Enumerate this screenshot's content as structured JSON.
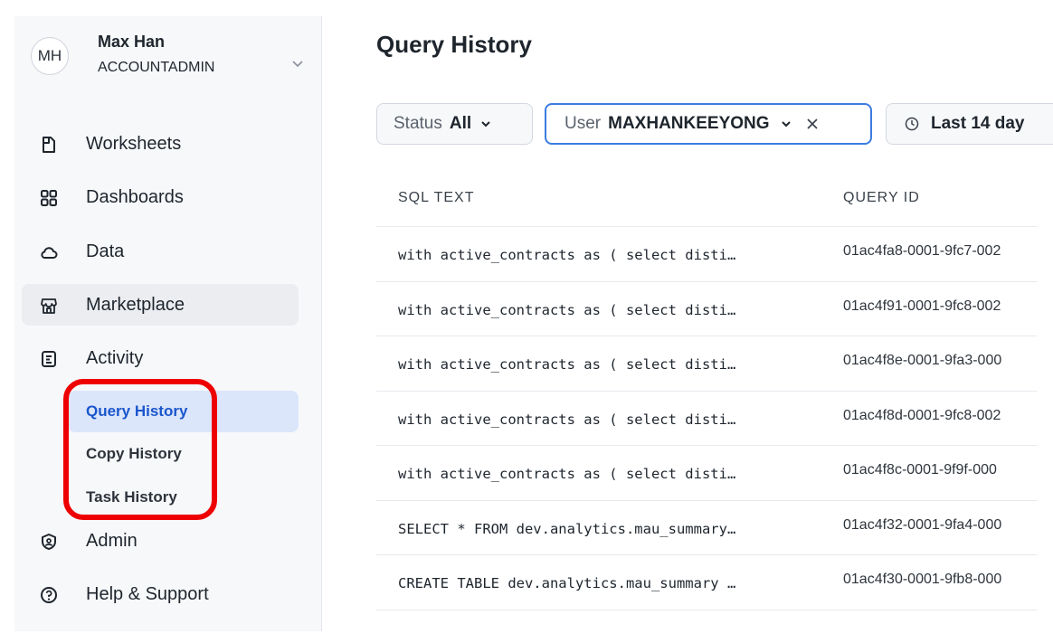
{
  "user": {
    "initials": "MH",
    "name": "Max Han",
    "role": "ACCOUNTADMIN"
  },
  "nav": [
    {
      "label": "Worksheets",
      "icon": "worksheet-icon"
    },
    {
      "label": "Dashboards",
      "icon": "dashboard-grid-icon"
    },
    {
      "label": "Data",
      "icon": "cloud-icon"
    },
    {
      "label": "Marketplace",
      "icon": "store-icon"
    },
    {
      "label": "Activity",
      "icon": "activity-doc-icon"
    },
    {
      "label": "Admin",
      "icon": "shield-icon"
    },
    {
      "label": "Help & Support",
      "icon": "help-icon"
    }
  ],
  "activity_sub": [
    {
      "label": "Query History"
    },
    {
      "label": "Copy History"
    },
    {
      "label": "Task History"
    }
  ],
  "page": {
    "title": "Query History"
  },
  "filters": {
    "status": {
      "key": "Status",
      "value": "All"
    },
    "user": {
      "key": "User",
      "value": "MAXHANKEEYONG"
    },
    "date": {
      "value": "Last 14 day"
    }
  },
  "table": {
    "headers": [
      "SQL TEXT",
      "QUERY ID"
    ],
    "rows": [
      {
        "sql": "with active_contracts as ( select disti…",
        "id": "01ac4fa8-0001-9fc7-002"
      },
      {
        "sql": "with active_contracts as ( select disti…",
        "id": "01ac4f91-0001-9fc8-002"
      },
      {
        "sql": "with active_contracts as ( select disti…",
        "id": "01ac4f8e-0001-9fa3-000"
      },
      {
        "sql": "with active_contracts as ( select disti…",
        "id": "01ac4f8d-0001-9fc8-002"
      },
      {
        "sql": "with active_contracts as ( select disti…",
        "id": "01ac4f8c-0001-9f9f-000"
      },
      {
        "sql": "SELECT * FROM dev.analytics.mau_summary…",
        "id": "01ac4f32-0001-9fa4-000"
      },
      {
        "sql": "CREATE TABLE dev.analytics.mau_summary …",
        "id": "01ac4f30-0001-9fb8-000"
      }
    ]
  },
  "colors": {
    "accent": "#1a56cc",
    "selected_bg": "#dce6fb",
    "highlight": "#ee0000"
  }
}
